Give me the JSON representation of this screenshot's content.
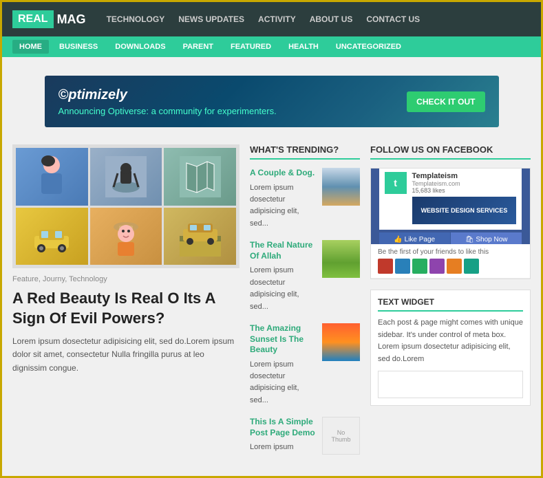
{
  "site": {
    "logo_real": "REAL",
    "logo_mag": "MAG"
  },
  "top_nav": {
    "links": [
      {
        "label": "TECHNOLOGY",
        "id": "technology"
      },
      {
        "label": "NEWS UPDATES",
        "id": "news-updates"
      },
      {
        "label": "ActivITY",
        "id": "activity"
      },
      {
        "label": "ABOUT US",
        "id": "about-us"
      },
      {
        "label": "CONTACT US",
        "id": "contact-us"
      }
    ]
  },
  "sub_nav": {
    "links": [
      {
        "label": "HOME",
        "id": "home"
      },
      {
        "label": "BUSINESS",
        "id": "business"
      },
      {
        "label": "DOWNLOADS",
        "id": "downloads"
      },
      {
        "label": "PARENT",
        "id": "parent"
      },
      {
        "label": "FEATURED",
        "id": "featured"
      },
      {
        "label": "HEALTH",
        "id": "health"
      },
      {
        "label": "UNCATEGORIZED",
        "id": "uncategorized"
      }
    ]
  },
  "banner": {
    "brand": "©ptimizely",
    "text": "Announcing Optiverse:",
    "subtext": "a community for experimenters.",
    "button": "cheCK It Out"
  },
  "article": {
    "meta": "Feature, Journy, Technology",
    "title": "A Red Beauty Is Real O Its A Sign Of Evil Powers?",
    "excerpt": "Lorem ipsum dosectetur adipisicing elit, sed do.Lorem ipsum dolor sit amet, consectetur Nulla fringilla purus at leo dignissim congue."
  },
  "trending": {
    "section_title": "WHAT'S TRENDING?",
    "items": [
      {
        "title": "A Couple & Dog.",
        "excerpt": "Lorem ipsum dosectetur adipisicing elit, sed...",
        "thumb_type": "bench"
      },
      {
        "title": "The Real Nature Of Allah",
        "excerpt": "Lorem ipsum dosectetur adipisicing elit, sed...",
        "thumb_type": "grass"
      },
      {
        "title": "The Amazing Sunset Is The Beauty",
        "excerpt": "Lorem ipsum dosectetur adipisicing elit, sed...",
        "thumb_type": "sunset"
      },
      {
        "title": "This Is A Simple Post Page Demo",
        "excerpt": "Lorem ipsum",
        "thumb_type": "nothumb"
      }
    ]
  },
  "facebook": {
    "section_title": "FOLLOW US ON FACEBOOK",
    "site_name": "Templateism",
    "site_url": "Templateism.com",
    "likes": "15,683 likes",
    "like_button": "👍 Like Page",
    "shop_button": "🛍 Shop Now",
    "friends_text": "Be the first of your friends to like this",
    "banner_text": "WEBSITE DESIGN SERVICES"
  },
  "text_widget": {
    "title": "TEXT WIDGET",
    "body": "Each post & page might comes with unique sidebar. It's under control of meta box. Lorem ipsum dosectetur adipisicing elit, sed do.Lorem"
  }
}
